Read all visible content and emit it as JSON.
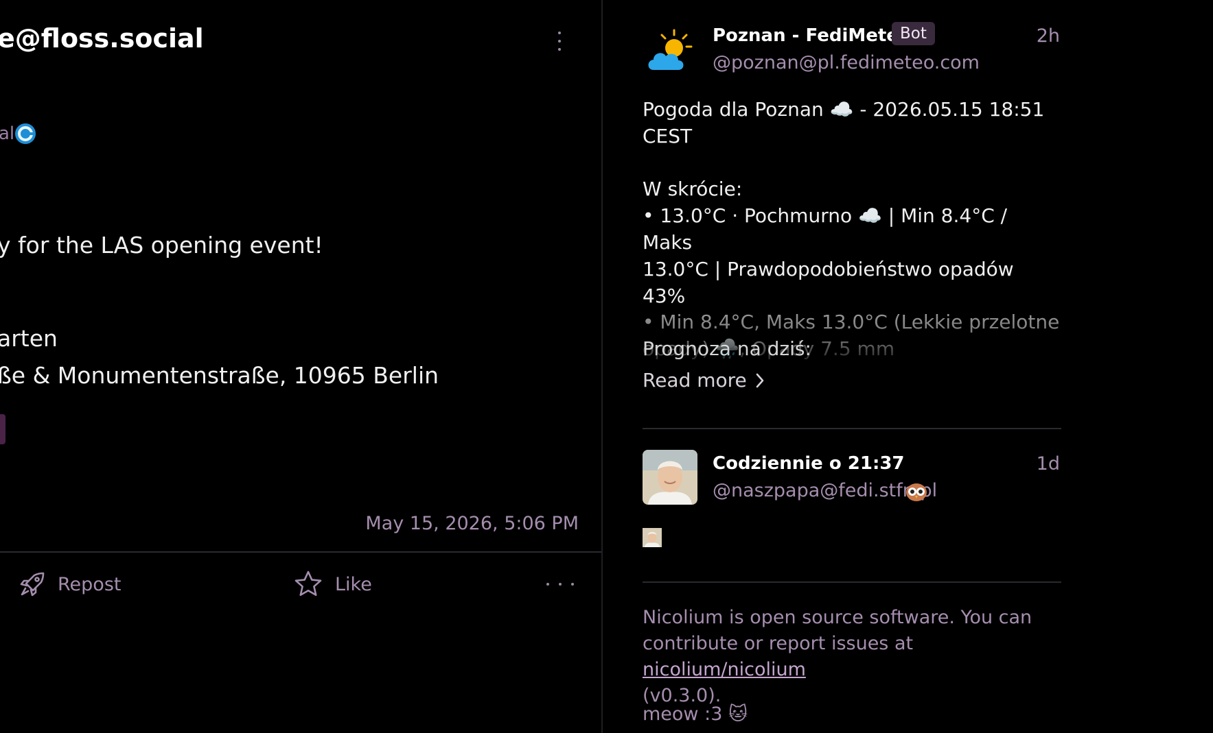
{
  "left": {
    "header_handle": "e@floss.social",
    "server_label": "al",
    "post_lines": [
      "y for the LAS opening event!",
      "arten",
      "ße & Monumentenstraße, 10965 Berlin"
    ],
    "timestamp": "May 15, 2026, 5:06 PM",
    "actions": {
      "repost_label": "Repost",
      "like_label": "Like"
    }
  },
  "right": {
    "post1": {
      "author": "Poznan - FediMeteo",
      "badge": "Bot",
      "handle": "@poznan@pl.fedimeteo.com",
      "time_ago": "2h",
      "line1": "Pogoda dla Poznan ☁️ - 2026.05.15 18:51",
      "line2": "CEST",
      "summary_heading": "W skrócie:",
      "summary_line1": "• 13.0°C · Pochmurno ☁️ | Min 8.4°C / Maks",
      "summary_line2": "13.0°C | Prawdopodobieństwo opadów 43%",
      "forecast_heading": "Prognoza na dziś:",
      "forecast_line1": "• Min 8.4°C, Maks 13.0°C (Lekkie przelotne",
      "forecast_line2": "opady) 🌧️, Opady 7.5 mm",
      "read_more": "Read more"
    },
    "post2": {
      "author": "Codziennie o 21:37",
      "handle": "@naszpapa@fedi.stfn.pl",
      "time_ago": "1d"
    },
    "footer": {
      "text_before": "Nicolium is open source software. You can contribute or report issues at ",
      "link": "nicolium/nicolium",
      "text_after": "(v0.3.0).",
      "meow": "meow :3 🐱"
    }
  },
  "colors": {
    "background": "#000000",
    "muted_purple": "#a58eae",
    "badge_bg": "#3a2a3d",
    "divider": "#2a2a2e"
  }
}
